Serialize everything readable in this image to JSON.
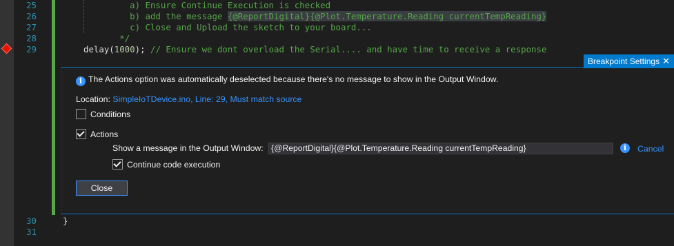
{
  "editor": {
    "lines": [
      {
        "num": "25",
        "text": "         a) Ensure Continue Execution is checked"
      },
      {
        "num": "26",
        "text_before": "         b) add the message ",
        "highlight": "{@ReportDigital}{@Plot.Temperature.Reading currentTempReading}"
      },
      {
        "num": "27",
        "text": "         c) Close and Upload the sketch to your board..."
      },
      {
        "num": "28",
        "text": "       */"
      },
      {
        "num": "29",
        "code": "delay(",
        "num_val": "1000",
        "code_end": "); ",
        "comment": "// Ensure we dont overload the Serial.... and have time to receive a response"
      },
      {
        "num": "30",
        "text": "}"
      },
      {
        "num": "31",
        "text": ""
      }
    ]
  },
  "breakpoint": {
    "tab_title": "Breakpoint Settings",
    "close_glyph": "✕",
    "info_glyph": "i",
    "info_message": "The Actions option was automatically deselected because there's no message to show in the Output Window.",
    "location_label": "Location: ",
    "location_value": "SimpleIoTDevice.ino, Line: 29, Must match source",
    "conditions_label": "Conditions",
    "conditions_checked": false,
    "actions_label": "Actions",
    "actions_checked": true,
    "message_label": "Show a message in the Output Window:",
    "message_value": "{@ReportDigital}{@Plot.Temperature.Reading currentTempReading}",
    "cancel_label": "Cancel",
    "continue_label": "Continue code execution",
    "continue_checked": true,
    "close_button": "Close"
  },
  "colors": {
    "accent": "#007acc",
    "link": "#3794ff",
    "comment": "#57a64a",
    "breakpoint": "#e51400"
  }
}
